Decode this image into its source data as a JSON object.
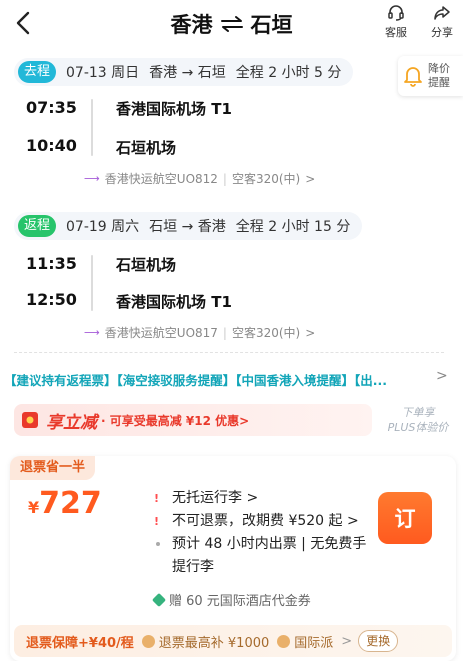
{
  "header": {
    "title_from": "香港",
    "title_to": "石垣",
    "service_label": "客服",
    "share_label": "分享"
  },
  "price_alert": {
    "label_line1": "降价",
    "label_line2": "提醒"
  },
  "outbound": {
    "tag": "去程",
    "date": "07-13 周日",
    "route": "香港 → 石垣",
    "duration": "全程 2 小时 5 分",
    "dep_time": "07:35",
    "dep_airport": "香港国际机场 T1",
    "arr_time": "10:40",
    "arr_airport": "石垣机场",
    "airline": "香港快运航空UO812",
    "aircraft": "空客320(中)"
  },
  "return": {
    "tag": "返程",
    "date": "07-19 周六",
    "route": "石垣 → 香港",
    "duration": "全程 2 小时 15 分",
    "dep_time": "11:35",
    "dep_airport": "石垣机场",
    "arr_time": "12:50",
    "arr_airport": "香港国际机场 T1",
    "airline": "香港快运航空UO817",
    "aircraft": "空客320(中)"
  },
  "notices": "【建议持有返程票】【海空接驳服务提醒】【中国香港入境提醒】【出...",
  "promo": {
    "title": "享立减",
    "desc": "· 可享受最高减 ¥12 优惠>"
  },
  "plus": {
    "line1": "下单享",
    "line2": "PLUS体验价"
  },
  "fare": {
    "tag": "退票省一半",
    "currency": "¥",
    "price": "727",
    "rule1": "无托运行李 >",
    "rule2": "不可退票，改期费 ¥520 起 >",
    "rule3": "预计 48 小时内出票 | 无免费手提行李",
    "coupon": "赠 60 元国际酒店代金券",
    "book_label": "订"
  },
  "strip": {
    "guard": "退票保障+¥40/程",
    "chip1": "退票最高补 ¥1000",
    "chip2": "国际派",
    "change": "更换"
  },
  "colors": {
    "accent_orange": "#ff5a1f",
    "outbound_tag": "#22b8d8",
    "return_tag": "#27c46b",
    "notice_teal": "#12a5b8",
    "promo_red": "#e9392b"
  }
}
